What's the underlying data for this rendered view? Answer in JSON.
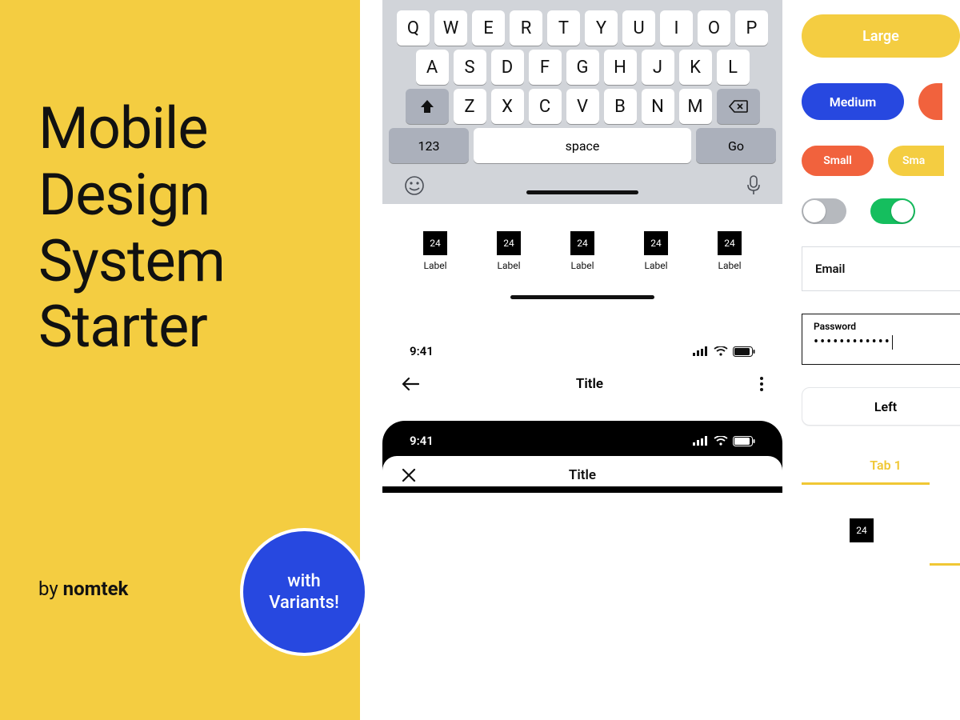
{
  "left_panel": {
    "headline_l1": "Mobile",
    "headline_l2": "Design",
    "headline_l3": "System",
    "headline_l4": "Starter",
    "byline_prefix": "by ",
    "byline_brand": "nomtek",
    "variants_l1": "with",
    "variants_l2": "Variants!"
  },
  "keyboard": {
    "row1": [
      "Q",
      "W",
      "E",
      "R",
      "T",
      "Y",
      "U",
      "I",
      "O",
      "P"
    ],
    "row2": [
      "A",
      "S",
      "D",
      "F",
      "G",
      "H",
      "J",
      "K",
      "L"
    ],
    "row3": [
      "Z",
      "X",
      "C",
      "V",
      "B",
      "N",
      "M"
    ],
    "numeric_label": "123",
    "space_label": "space",
    "go_label": "Go"
  },
  "tabbar": {
    "items": [
      {
        "size": "24",
        "label": "Label"
      },
      {
        "size": "24",
        "label": "Label"
      },
      {
        "size": "24",
        "label": "Label"
      },
      {
        "size": "24",
        "label": "Label"
      },
      {
        "size": "24",
        "label": "Label"
      }
    ]
  },
  "status": {
    "time": "9:41"
  },
  "nav": {
    "title": "Title",
    "title2": "Title"
  },
  "buttons": {
    "large": "Large",
    "medium": "Medium",
    "small": "Small",
    "small2": "Sma"
  },
  "inputs": {
    "email_label": "Email",
    "password_label": "Password",
    "password_value": "••••••••••••"
  },
  "segment": {
    "left": "Left"
  },
  "tabs": {
    "tab1": "Tab 1"
  },
  "mini": {
    "size": "24"
  }
}
